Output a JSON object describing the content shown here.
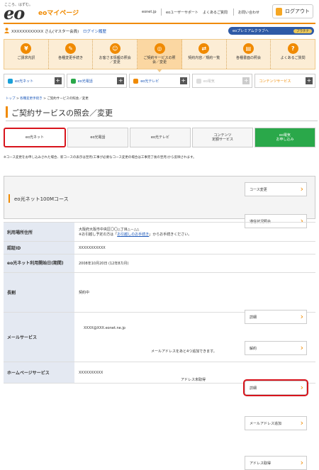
{
  "header": {
    "tagline": "こころ、はずむ。",
    "logo": "eo",
    "mypage": "eoマイページ",
    "links": [
      "eonet.jp",
      "eoユーザーサポート",
      "よくあるご質問",
      "お問い合わせ"
    ],
    "logout": "ログアウト"
  },
  "user": {
    "name": "XXXXXXXXXXXX さん(マスター会員)",
    "login_history": "ログイン履歴",
    "premium": "eoプレミアムクラブへ",
    "premium_level": "プラチナ"
  },
  "menu": [
    {
      "icon": "¥",
      "label": "ご請求内訳"
    },
    {
      "icon": "✎",
      "label": "各種変更手続き"
    },
    {
      "icon": "☺",
      "label": "お客さま情報の照会／変更"
    },
    {
      "icon": "◎",
      "label": "ご契約サービスの照会／変更"
    },
    {
      "icon": "⇄",
      "label": "契約内容／規約一覧"
    },
    {
      "icon": "▤",
      "label": "各種書面の照会"
    },
    {
      "icon": "?",
      "label": "よくあるご質問"
    }
  ],
  "services": [
    {
      "label": "eo光ネット"
    },
    {
      "label": "eo光電話"
    },
    {
      "label": "eo光テレビ"
    },
    {
      "label": "eo電気"
    },
    {
      "label": "コンテンツサービス"
    }
  ],
  "breadcrumb": {
    "items": [
      "トップ",
      "各種変更手続き"
    ],
    "current": "ご契約サービスの照会／変更",
    "sep": ">"
  },
  "page_title": "ご契約サービスの照会／変更",
  "tabs": [
    {
      "label": "eo光ネット"
    },
    {
      "label": "eo光電話"
    },
    {
      "label": "eo光テレビ"
    },
    {
      "label": "コンテンツ\n定額サービス"
    },
    {
      "label": "eo電気\nお申し込み"
    }
  ],
  "note": "※コース変更をお申し込みされた場合、新コースの表示は翌月(工事が必要なコース変更の場合は工事完了後の翌月)から反映されます。",
  "course": {
    "title": "eo光ネット100Mコース",
    "btn_change": "コース変更",
    "btn_speed": "通信状況照会"
  },
  "table": {
    "address_label": "利用場所住所",
    "address_value": "大阪府大阪市中央区〇〇△丁目△－△△",
    "address_note_pre": "※お引越し予定の方は「",
    "address_note_link": "お引越しのお手続き",
    "address_note_post": "」からお手続きください。",
    "auth_label": "認証ID",
    "auth_value": "XXXXXXXXXXX",
    "start_label": "eo光ネット利用開始日(期間)",
    "start_value": "2008年10月20日 (12年8カ月)",
    "long_label": "長割",
    "long_value": "契約中",
    "btn_detail": "詳細",
    "btn_cancel": "解約",
    "mail_label": "メールサービス",
    "mail_value": "XXXX@XXX.eonet.ne.jp",
    "mail_btn_detail": "詳細",
    "mail_more": "メールアドレスをあと4つ追加できます。",
    "mail_btn_add": "メールアドレス追加",
    "hp_label": "ホームページサービス",
    "hp_value": "XXXXXXXXXX",
    "hp_status": "アドレス未取得",
    "hp_btn": "アドレス取得"
  }
}
